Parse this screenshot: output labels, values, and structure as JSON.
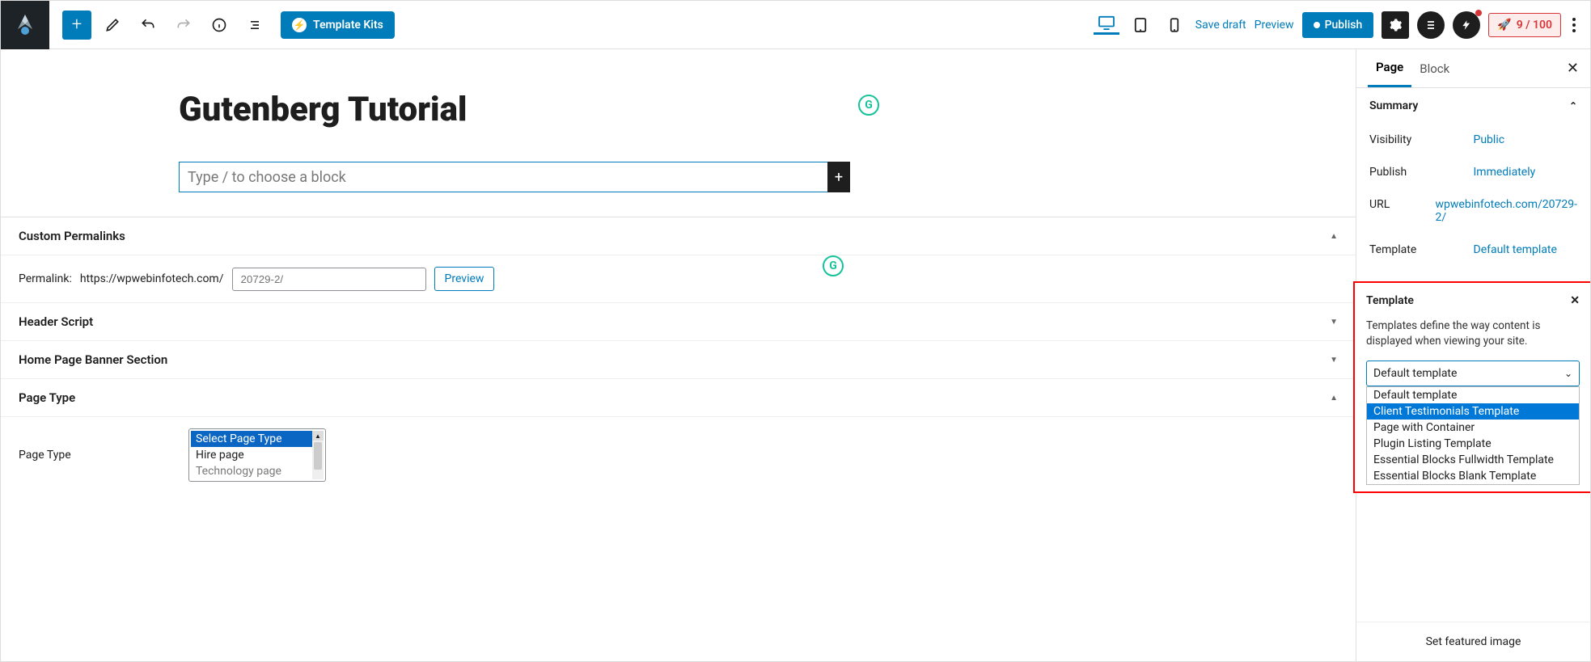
{
  "toolbar": {
    "template_kits": "Template Kits",
    "save_draft": "Save draft",
    "preview": "Preview",
    "publish": "Publish",
    "score": "9 / 100"
  },
  "editor": {
    "title": "Gutenberg Tutorial",
    "placeholder": "Type / to choose a block"
  },
  "meta": {
    "custom_permalinks": "Custom Permalinks",
    "permalink_label": "Permalink:",
    "permalink_base": "https://wpwebinfotech.com/",
    "permalink_slug": "20729-2/",
    "preview": "Preview",
    "header_script": "Header Script",
    "banner_section": "Home Page Banner Section",
    "page_type_head": "Page Type",
    "page_type_label": "Page Type",
    "page_type_options": [
      "Select Page Type",
      "Hire page",
      "Technology page"
    ]
  },
  "sidebar": {
    "tabs": {
      "page": "Page",
      "block": "Block"
    },
    "summary": "Summary",
    "visibility_k": "Visibility",
    "visibility_v": "Public",
    "publish_k": "Publish",
    "publish_v": "Immediately",
    "url_k": "URL",
    "url_v": "wpwebinfotech.com/20729-2/",
    "template_k": "Template",
    "template_v": "Default template",
    "set_featured": "Set featured image"
  },
  "template_pop": {
    "title": "Template",
    "desc": "Templates define the way content is displayed when viewing your site.",
    "selected": "Default template",
    "options": [
      "Default template",
      "Client Testimonials Template",
      "Page with Container",
      "Plugin Listing Template",
      "Essential Blocks Fullwidth Template",
      "Essential Blocks Blank Template"
    ],
    "highlight_index": 1
  }
}
